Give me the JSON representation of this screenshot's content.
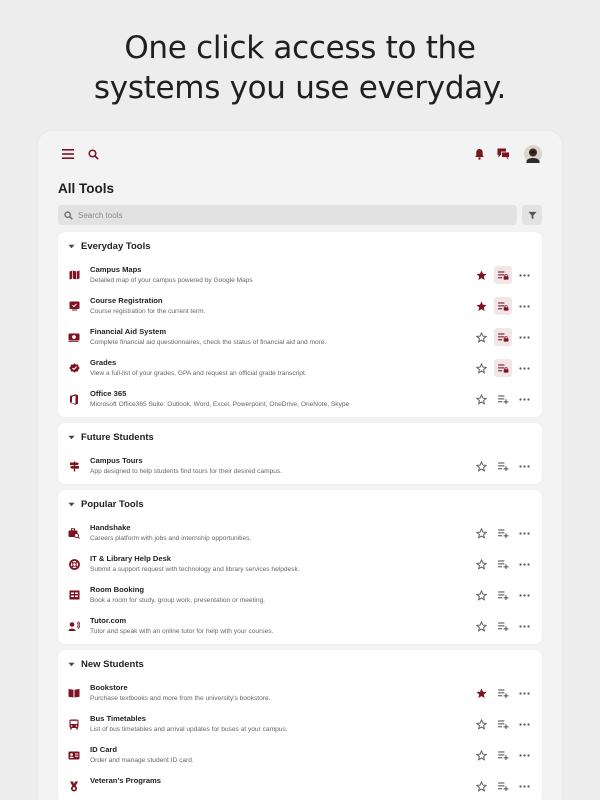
{
  "headline": {
    "line1": "One click access to the",
    "line2": "systems you use everyday."
  },
  "topbar": {
    "menu_icon": "menu-icon",
    "search_icon": "search-icon",
    "notifications_icon": "bell-icon",
    "messages_icon": "chat-icon",
    "avatar": "user-avatar"
  },
  "page": {
    "title": "All Tools",
    "search_placeholder": "Search tools"
  },
  "colors": {
    "brand": "#7d1220",
    "icon_gray": "#5f5f5f",
    "background": "#ededed"
  },
  "sections": [
    {
      "title": "Everyday Tools",
      "items": [
        {
          "name": "Campus Maps",
          "desc": "Detailed map of your campus powered by Google Maps",
          "icon": "map-icon",
          "starred": true,
          "in_list": true
        },
        {
          "name": "Course Registration",
          "desc": "Course registration for the current term.",
          "icon": "registration-icon",
          "starred": true,
          "in_list": true
        },
        {
          "name": "Financial Aid System",
          "desc": "Complete financial aid questionnaires, check the status of financial aid and more.",
          "icon": "money-icon",
          "starred": false,
          "in_list": true
        },
        {
          "name": "Grades",
          "desc": "View a full-list of your grades, GPA and request an official grade transcript.",
          "icon": "verified-badge-icon",
          "starred": false,
          "in_list": true
        },
        {
          "name": "Office 365",
          "desc": "Microsoft Office365 Suite: Outlook, Word, Excel, Powerpoint, OneDrive, OneNote, Skype",
          "icon": "office-icon",
          "starred": false,
          "in_list": false
        }
      ]
    },
    {
      "title": "Future Students",
      "items": [
        {
          "name": "Campus Tours",
          "desc": "App designed to help students find tours for their desired campus.",
          "icon": "signpost-icon",
          "starred": false,
          "in_list": false
        }
      ]
    },
    {
      "title": "Popular Tools",
      "items": [
        {
          "name": "Handshake",
          "desc": "Careers platform with jobs and internship opportunities.",
          "icon": "briefcase-search-icon",
          "starred": false,
          "in_list": false
        },
        {
          "name": "IT & Library Help Desk",
          "desc": "Submit a support request with technology and library services helpdesk.",
          "icon": "lifebuoy-icon",
          "starred": false,
          "in_list": false
        },
        {
          "name": "Room Booking",
          "desc": "Book a room for study, group work, presentation or meeting.",
          "icon": "room-icon",
          "starred": false,
          "in_list": false
        },
        {
          "name": "Tutor.com",
          "desc": "Tutor and speak with an online tutor for help with your courses.",
          "icon": "tutor-icon",
          "starred": false,
          "in_list": false
        }
      ]
    },
    {
      "title": "New Students",
      "items": [
        {
          "name": "Bookstore",
          "desc": "Purchase textbooks and more from the university's bookstore.",
          "icon": "book-icon",
          "starred": true,
          "in_list": false
        },
        {
          "name": "Bus Timetables",
          "desc": "List of bus timetables and arrival updates for buses at your campus.",
          "icon": "bus-icon",
          "starred": false,
          "in_list": false
        },
        {
          "name": "ID Card",
          "desc": "Order and manage student ID card.",
          "icon": "id-card-icon",
          "starred": false,
          "in_list": false
        },
        {
          "name": "Veteran's Programs",
          "desc": "",
          "icon": "medal-icon",
          "starred": false,
          "in_list": false
        }
      ]
    }
  ]
}
